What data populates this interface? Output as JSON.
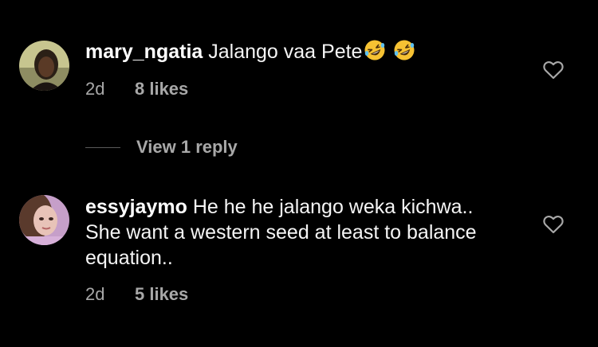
{
  "comments": [
    {
      "username": "mary_ngatia",
      "text": "Jalango vaa Pete",
      "emoji": [
        "rolling-on-floor-laughing",
        "rolling-on-floor-laughing"
      ],
      "time": "2d",
      "likes": "8 likes",
      "view_replies": "View 1 reply"
    },
    {
      "username": "essyjaymo",
      "text": "He he he jalango weka kichwa.. She want a western seed at least to balance equation..",
      "time": "2d",
      "likes": "5 likes"
    }
  ],
  "colors": {
    "background": "#000000",
    "text": "#ffffff",
    "secondary": "#a8a8a8",
    "emoji": "#f6c233"
  }
}
